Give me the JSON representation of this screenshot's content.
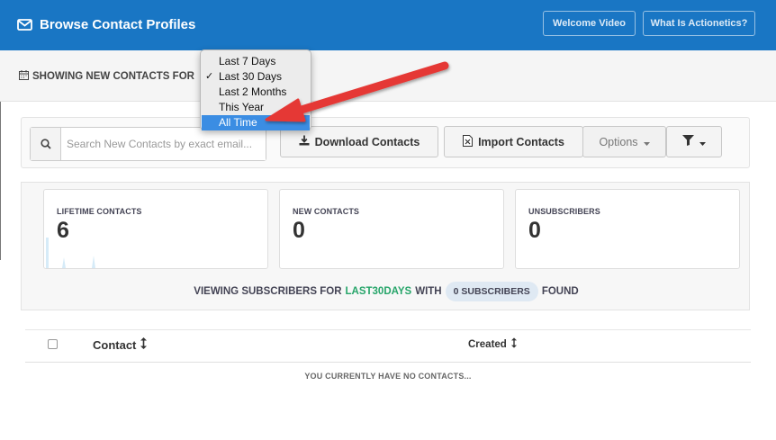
{
  "header": {
    "title": "Browse Contact Profiles",
    "title_icon": "envelope-icon",
    "buttons": {
      "welcome_video": "Welcome Video",
      "what_is": "What Is Actionetics?"
    }
  },
  "filter": {
    "showing_label": "SHOWING NEW CONTACTS FOR",
    "icon": "calendar-icon",
    "options": [
      "Last 7 Days",
      "Last 30 Days",
      "Last 2 Months",
      "This Year",
      "All Time"
    ],
    "checked": "Last 30 Days",
    "highlighted": "All Time"
  },
  "toolbar": {
    "search_placeholder": "Search New Contacts by exact email...",
    "search_icon": "search-icon",
    "download_label": "Download Contacts",
    "import_label": "Import Contacts",
    "options_label": "Options",
    "filter_icon": "filter-icon"
  },
  "stats": {
    "lifetime": {
      "label": "LIFETIME CONTACTS",
      "value": "6"
    },
    "new": {
      "label": "NEW CONTACTS",
      "value": "0"
    },
    "unsubscribers": {
      "label": "UNSUBSCRIBERS",
      "value": "0"
    },
    "viewing_prefix": "VIEWING SUBSCRIBERS FOR",
    "viewing_period": "LAST30DAYS",
    "viewing_with": "WITH",
    "subscribers_pill": "0 SUBSCRIBERS",
    "viewing_suffix": "FOUND"
  },
  "table": {
    "col_contact": "Contact",
    "col_created": "Created",
    "sort_icon": "sort-icon",
    "empty_message": "YOU CURRENTLY HAVE NO CONTACTS..."
  },
  "colors": {
    "header_blue": "#1976c4",
    "highlight_blue": "#3b8de3",
    "period_green": "#27a56a",
    "annotation_arrow_red": "#e53935"
  }
}
